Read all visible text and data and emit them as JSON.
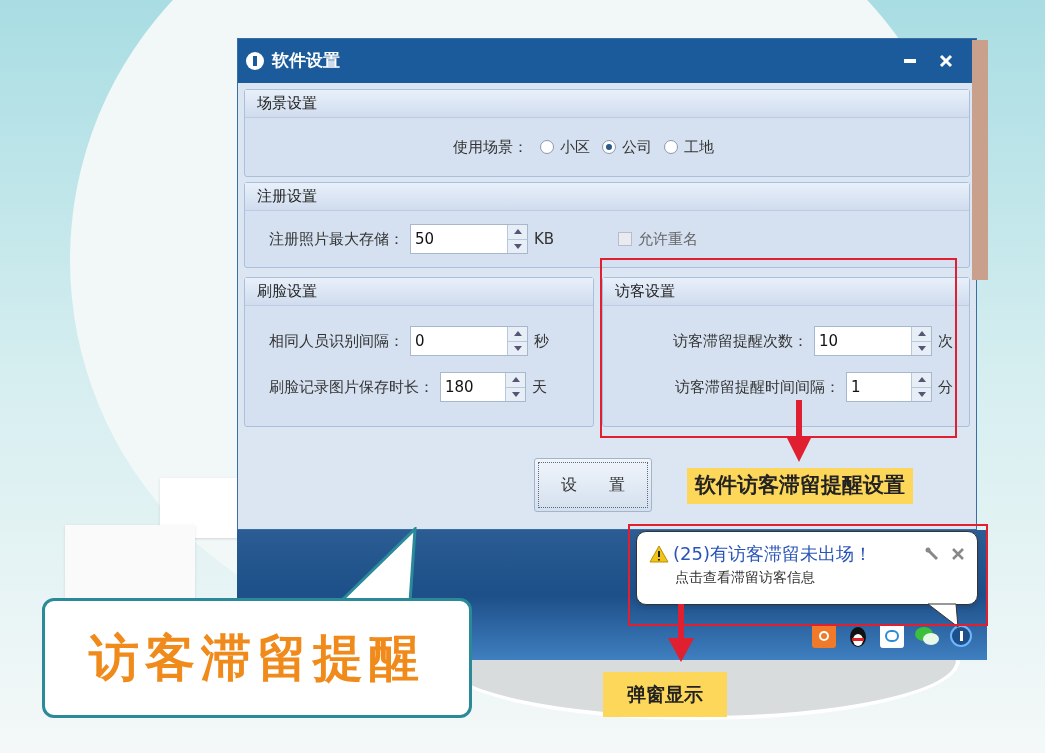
{
  "window": {
    "title": "软件设置",
    "scene": {
      "title": "场景设置",
      "label": "使用场景：",
      "options": [
        {
          "label": "小区",
          "selected": false
        },
        {
          "label": "公司",
          "selected": true
        },
        {
          "label": "工地",
          "selected": false
        }
      ]
    },
    "register": {
      "title": "注册设置",
      "field": {
        "label": "注册照片最大存储：",
        "value": "50",
        "unit": "KB"
      },
      "checkbox": {
        "label": "允许重名",
        "checked": false,
        "disabled": true
      }
    },
    "face": {
      "title": "刷脸设置",
      "fields": [
        {
          "label": "相同人员识别间隔：",
          "value": "0",
          "unit": "秒"
        },
        {
          "label": "刷脸记录图片保存时长：",
          "value": "180",
          "unit": "天"
        }
      ]
    },
    "visitor": {
      "title": "访客设置",
      "fields": [
        {
          "label": "访客滞留提醒次数：",
          "value": "10",
          "unit": "次"
        },
        {
          "label": "访客滞留提醒时间间隔：",
          "value": "1",
          "unit": "分"
        }
      ]
    },
    "button": "设　　置"
  },
  "callouts": [
    "软件访客滞留提醒设置",
    "弹窗显示"
  ],
  "notification": {
    "title": "(25)有访客滞留未出场！",
    "message": "点击查看滞留访客信息"
  },
  "headline": "访客滞留提醒"
}
